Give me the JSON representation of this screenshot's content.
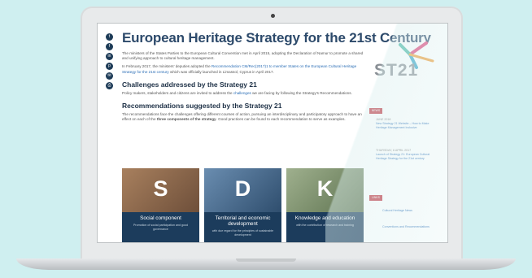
{
  "page": {
    "title": "European Heritage Strategy for the 21st Century",
    "intro_1": "The ministers of the States Parties to the European Cultural Convention met in April 2015, adopting the Declaration of Namur to promote a shared and unifying approach to cultural heritage management.",
    "intro_2_prefix": "In February 2017, the ministers' deputies adopted the ",
    "intro_2_link": "Recommendation CM/Rec(2017)1 to member States on the European Cultural Heritage Strategy for the 21st century",
    "intro_2_suffix": " which was officially launched in Limassol, Cyprus in April 2017.",
    "section_1_heading": "Challenges addressed by the Strategy 21",
    "section_1_prefix": "Policy makers, stakeholders and citizens are invited to address the ",
    "section_1_link": "challenges",
    "section_1_suffix": " we are facing by following the Strategy's Recommendations.",
    "section_2_heading": "Recommendations suggested by the Strategy 21",
    "section_2_text_prefix": "The recommendations face the challenges offering different courses of action, pursuing an interdisciplinary and participatory approach to have an effect on each of the ",
    "section_2_bold": "three components of the strategy",
    "section_2_text_suffix": ". Good practices can be found to each recommendation to serve as examples."
  },
  "share_icons": [
    "twitter-icon",
    "facebook-icon",
    "linkedin-icon",
    "pinterest-icon",
    "email-icon",
    "print-icon"
  ],
  "cards": [
    {
      "letter": "S",
      "title": "Social component",
      "subtitle": "Promotion of social participation and good governance",
      "color": "#8c6a4f"
    },
    {
      "letter": "D",
      "title": "Territorial and economic development",
      "subtitle": "with due regard for the principles of sustainable development",
      "color": "#4a6c8c"
    },
    {
      "letter": "K",
      "title": "Knowledge and education",
      "subtitle": "with the contribution of research and training",
      "color": "#7a8f6a"
    }
  ],
  "sidebar": {
    "logo_text": "ST21",
    "news_tag": "NEWS",
    "news": [
      {
        "date": "JUNE 2018",
        "link": "New Strategy 21 Website – How to Make Heritage Management Inclusive"
      },
      {
        "date": "THURSDAY, 6 APRIL 2017",
        "link": "Launch of Strategy 21: European Cultural Heritage Strategy for the 21st century"
      }
    ],
    "links_tag": "LINKS",
    "links": [
      "Cultural Heritage News",
      "Conventions and Recommendations"
    ]
  },
  "colors": {
    "background": "#cfeff0",
    "title": "#2d4a6b",
    "card_band": "#1c3c5c",
    "tag": "#c0343f",
    "link": "#2a6db5"
  }
}
